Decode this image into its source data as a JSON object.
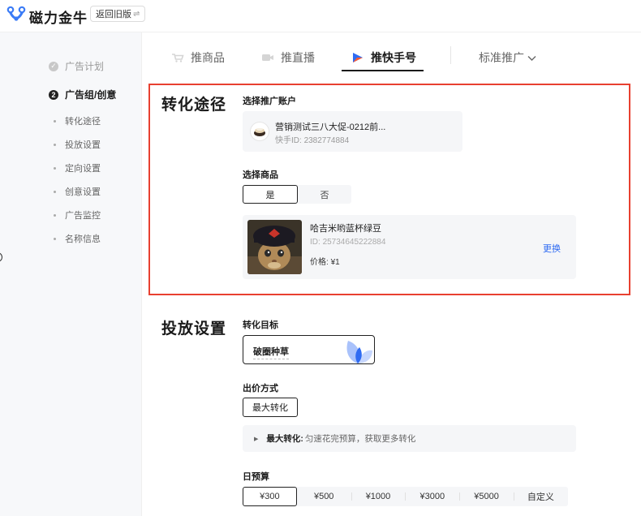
{
  "header": {
    "app_name": "磁力金牛",
    "old_version_label": "返回旧版",
    "swap_icon": "⇌"
  },
  "sidebar": {
    "steps": [
      {
        "label": "广告计划",
        "status": "done",
        "marker": "✓"
      },
      {
        "label": "广告组/创意",
        "status": "active",
        "marker": "2"
      }
    ],
    "substeps": [
      "转化途径",
      "投放设置",
      "定向设置",
      "创意设置",
      "广告监控",
      "名称信息"
    ]
  },
  "tabs": {
    "items": [
      {
        "label": "推商品",
        "icon": "cart-icon"
      },
      {
        "label": "推直播",
        "icon": "live-icon"
      },
      {
        "label": "推快手号",
        "icon": "kuaishou-play-icon"
      }
    ],
    "active_index": 2,
    "mode_select": "标准推广",
    "mode_chevron": "⌄"
  },
  "conversion": {
    "title": "转化途径",
    "account_label": "选择推广账户",
    "account": {
      "name": "营销测试三八大促-0212前...",
      "id_label": "快手ID:",
      "id": "2382774884"
    },
    "product_label": "选择商品",
    "product_toggle": {
      "options": [
        "是",
        "否"
      ],
      "selected": 0
    },
    "product": {
      "name": "哈吉米哟蓝杯绿豆",
      "id_label": "ID:",
      "id": "25734645222884",
      "price_label": "价格:",
      "price": "¥1",
      "change_label": "更换"
    }
  },
  "delivery": {
    "title": "投放设置",
    "target_label": "转化目标",
    "target_value": "破圈种草",
    "bid_label": "出价方式",
    "bid_value": "最大转化",
    "bid_info_key": "最大转化:",
    "bid_info_text": "匀速花完预算，获取更多转化",
    "budget_label": "日预算",
    "budget_options": [
      "¥300",
      "¥500",
      "¥1000",
      "¥3000",
      "¥5000",
      "自定义"
    ],
    "budget_selected": 0
  },
  "colors": {
    "highlight_border": "#e84030",
    "link": "#2f6bf2",
    "logo_blue": "#3a7bf6"
  }
}
